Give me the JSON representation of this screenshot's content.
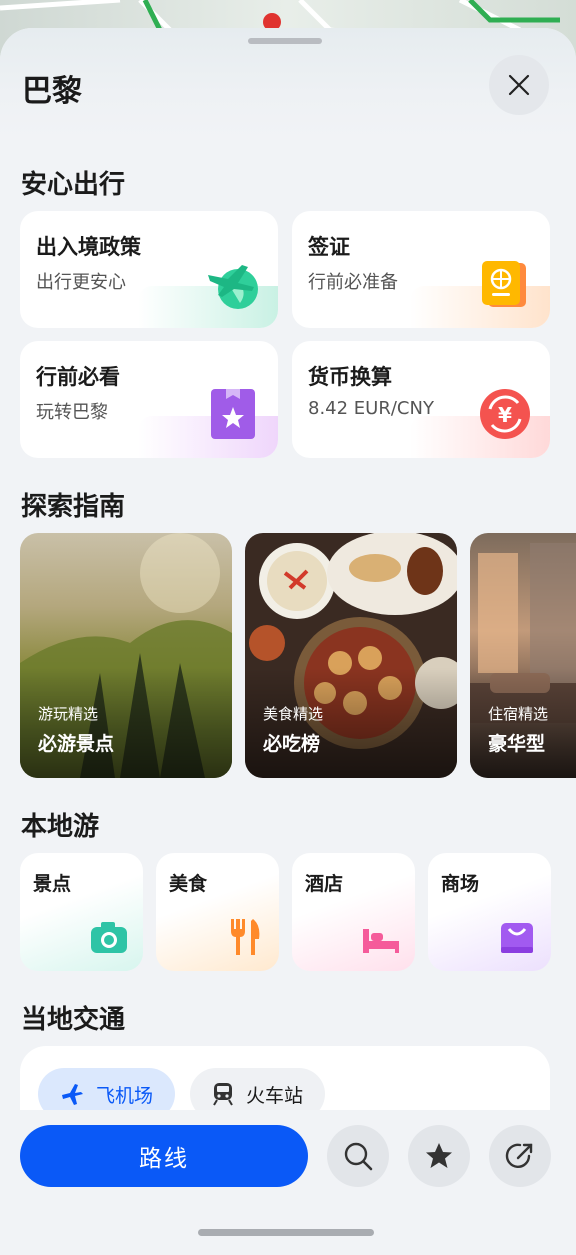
{
  "header": {
    "title": "巴黎"
  },
  "sections": {
    "safe_travel": "安心出行",
    "explore": "探索指南",
    "local_tour": "本地游",
    "transport": "当地交通"
  },
  "safe_cards": [
    {
      "title": "出入境政策",
      "subtitle": "出行更安心",
      "icon": "plane-globe-icon"
    },
    {
      "title": "签证",
      "subtitle": "行前必准备",
      "icon": "passport-icon"
    },
    {
      "title": "行前必看",
      "subtitle": "玩转巴黎",
      "icon": "bookmark-star-icon"
    },
    {
      "title": "货币换算",
      "subtitle": "8.42 EUR/CNY",
      "icon": "currency-exchange-icon"
    }
  ],
  "guides": [
    {
      "tag": "游玩精选",
      "title": "必游景点"
    },
    {
      "tag": "美食精选",
      "title": "必吃榜"
    },
    {
      "tag": "住宿精选",
      "title": "豪华型"
    }
  ],
  "local": [
    {
      "label": "景点",
      "icon": "camera-icon"
    },
    {
      "label": "美食",
      "icon": "fork-knife-icon"
    },
    {
      "label": "酒店",
      "icon": "bed-icon"
    },
    {
      "label": "商场",
      "icon": "shopping-bag-icon"
    }
  ],
  "transport_tabs": [
    {
      "label": "飞机场",
      "icon": "airplane-icon",
      "selected": true
    },
    {
      "label": "火车站",
      "icon": "train-icon",
      "selected": false
    }
  ],
  "bottom": {
    "route_label": "路线"
  },
  "colors": {
    "accent": "#0a59f7",
    "airport_chip": "#dbe8fd"
  }
}
